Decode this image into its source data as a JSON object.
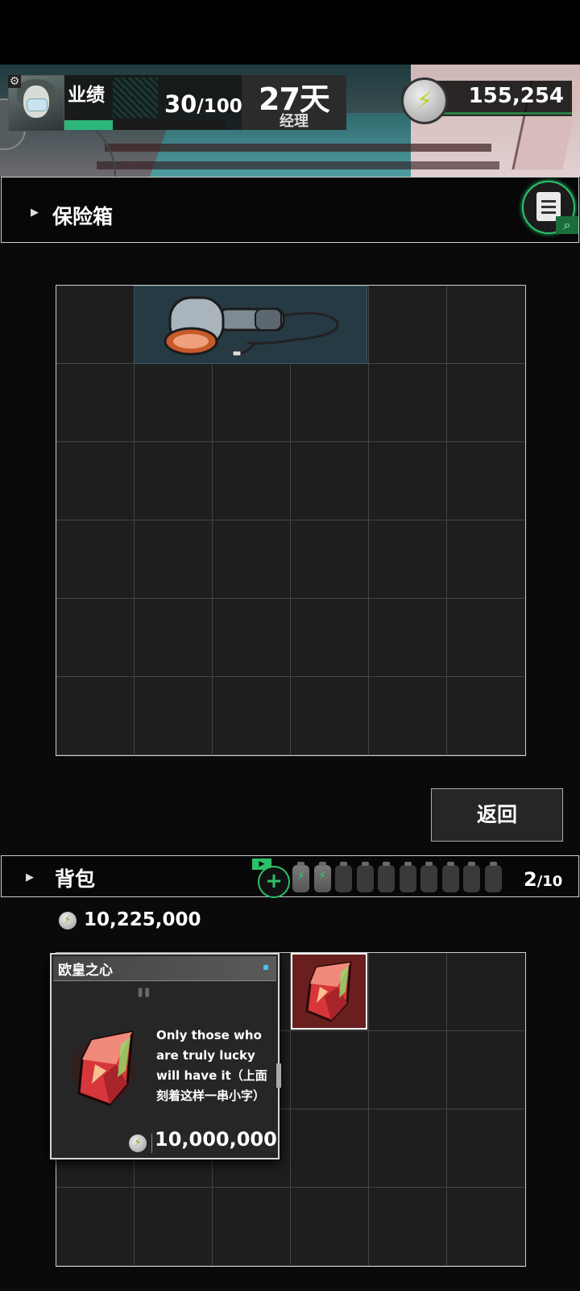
{
  "header": {
    "performance_label": "业绩",
    "performance_current": "30",
    "performance_total": "/100",
    "performance_progress": 0.3,
    "days": "27天",
    "title": "经理",
    "balance": "155,254"
  },
  "safe": {
    "title": "保险箱",
    "back_label": "返回"
  },
  "backpack": {
    "title": "背包",
    "count": "2",
    "capacity": "/10",
    "filled_slots": 2,
    "total_slots": 10,
    "wallet": "10,225,000"
  },
  "tooltip": {
    "name": "欧皇之心",
    "description": "Only those who are truly lucky will have it（上面刻着这样一串小字）",
    "price": "10,000,000"
  },
  "icons": {
    "coin": "lightning-coin-icon",
    "log": "clipboard-search-icon",
    "expand": "plus-icon",
    "arrow": "triangle-right-icon"
  },
  "colors": {
    "accent_green": "#2cc069",
    "item_bg_blue": "#263a44",
    "item_bg_red": "#6a1f1f"
  }
}
